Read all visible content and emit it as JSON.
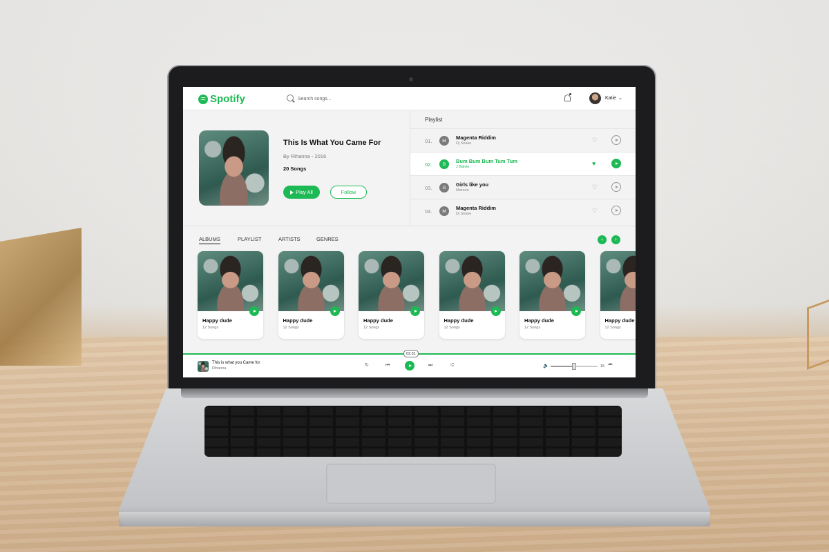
{
  "header": {
    "brand": "Spotify",
    "search_placeholder": "Search songs...",
    "user_name": "Katie"
  },
  "hero": {
    "title": "This Is What You Came For",
    "byline": "By Rihanna - 2016",
    "song_count": "20 Songs",
    "play_all_label": "Play All",
    "follow_label": "Follow"
  },
  "playlist": {
    "title": "Playlist",
    "tracks": [
      {
        "num": "01.",
        "letter": "M",
        "name": "Magenta Riddim",
        "artist": "Dj Snake",
        "active": false
      },
      {
        "num": "02.",
        "letter": "B",
        "name": "Bum Bum Bum Tum Tum",
        "artist": "J Balvin",
        "active": true
      },
      {
        "num": "03.",
        "letter": "G",
        "name": "Girls like you",
        "artist": "Maroon",
        "active": false
      },
      {
        "num": "04.",
        "letter": "M",
        "name": "Magenta Riddim",
        "artist": "Dj Snake",
        "active": false
      }
    ]
  },
  "tabs": [
    "ALBUMS",
    "PLAYLIST",
    "ARTISTS",
    "GENRES"
  ],
  "active_tab": "ALBUMS",
  "albums": [
    {
      "name": "Happy dude",
      "count": "12 Songs"
    },
    {
      "name": "Happy dude",
      "count": "12 Songs"
    },
    {
      "name": "Happy dude",
      "count": "12 Songs"
    },
    {
      "name": "Happy dude",
      "count": "12 Songs"
    },
    {
      "name": "Happy dude",
      "count": "12 Songs"
    },
    {
      "name": "Happy dude",
      "count": "12 Songs"
    }
  ],
  "player": {
    "elapsed": "02:31",
    "title": "This is what you Came for",
    "artist": "Rihanna",
    "volume": "15",
    "volume_level": 0.5
  },
  "colors": {
    "accent": "#1db954",
    "screen_bg": "#f3f3f3"
  },
  "icons": {
    "search": "search-icon",
    "bell": "bell-icon",
    "heart": "heart-icon",
    "play": "play-icon",
    "repeat": "repeat-icon",
    "shuffle": "shuffle-icon",
    "volume": "volume-icon"
  }
}
